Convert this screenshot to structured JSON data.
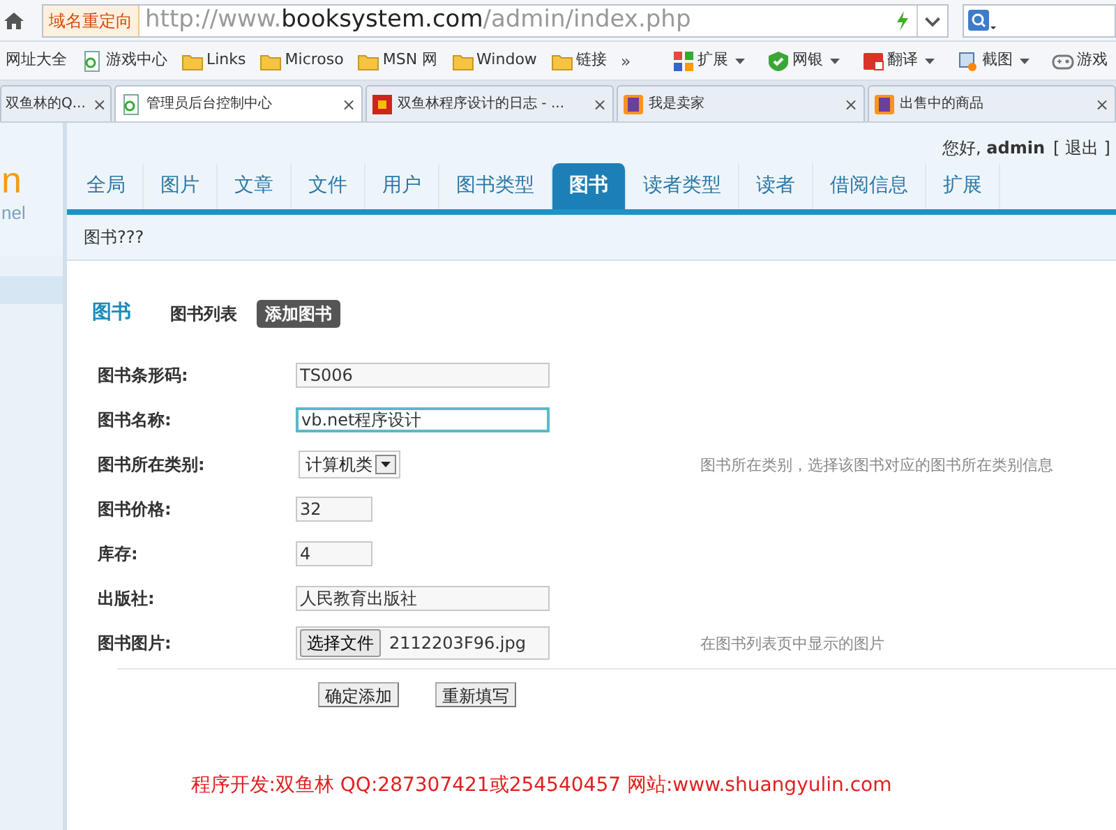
{
  "browser": {
    "address_badge": "域名重定向",
    "url": "http://www.**booksystem.com**/admin/index.php",
    "bookmarks": [
      {
        "label": "网址大全",
        "kind": "plain"
      },
      {
        "label": "游戏中心",
        "kind": "page"
      },
      {
        "label": "Links",
        "kind": "folder"
      },
      {
        "label": "Microso",
        "kind": "folder"
      },
      {
        "label": "MSN 网",
        "kind": "folder"
      },
      {
        "label": "Window",
        "kind": "folder"
      },
      {
        "label": "链接",
        "kind": "folder"
      }
    ],
    "bookmarks_more": "»",
    "tools": [
      {
        "label": "扩展",
        "menu": true
      },
      {
        "label": "网银",
        "menu": true
      },
      {
        "label": "翻译",
        "menu": true
      },
      {
        "label": "截图",
        "menu": true
      },
      {
        "label": "游戏",
        "menu": false
      }
    ],
    "tabs": [
      {
        "title": "双鱼林的Q...",
        "kind": "plain",
        "close": "×",
        "selected": false
      },
      {
        "title": "管理员后台控制中心",
        "kind": "page",
        "close": "×",
        "selected": true
      },
      {
        "title": "双鱼林程序设计的日志 - ...",
        "kind": "blog",
        "close": "×",
        "selected": false
      },
      {
        "title": "我是卖家",
        "kind": "shop",
        "close": "×",
        "selected": false
      },
      {
        "title": "出售中的商品",
        "kind": "shop",
        "close": "×",
        "selected": false
      }
    ]
  },
  "site": {
    "logo_letter": "n",
    "logo_sub": "nel",
    "greeting": "您好, ",
    "user": "admin",
    "logout": "[ 退出 ]",
    "nav": [
      {
        "label": "全局",
        "selected": false
      },
      {
        "label": "图片",
        "selected": false
      },
      {
        "label": "文章",
        "selected": false
      },
      {
        "label": "文件",
        "selected": false
      },
      {
        "label": "用户",
        "selected": false
      },
      {
        "label": "图书类型",
        "selected": false
      },
      {
        "label": "图书",
        "selected": true
      },
      {
        "label": "读者类型",
        "selected": false
      },
      {
        "label": "读者",
        "selected": false
      },
      {
        "label": "借阅信息",
        "selected": false
      },
      {
        "label": "扩展",
        "selected": false
      }
    ],
    "breadcrumb": "图书???"
  },
  "section": {
    "title": "图书",
    "subtabs": [
      {
        "label": "图书列表",
        "selected": false
      },
      {
        "label": "添加图书",
        "selected": true
      }
    ]
  },
  "form": {
    "fields": [
      {
        "label": "图书条形码:",
        "kind": "text",
        "value": "TS006",
        "focused": false
      },
      {
        "label": "图书名称:",
        "kind": "text",
        "value": "vb.net程序设计",
        "focused": true
      },
      {
        "label": "图书所在类别:",
        "kind": "select",
        "value": "计算机类",
        "focused": false,
        "hint": "图书所在类别，选择该图书对应的图书所在类别信息"
      },
      {
        "label": "图书价格:",
        "kind": "short",
        "value": "32",
        "focused": false
      },
      {
        "label": "库存:",
        "kind": "short",
        "value": "4",
        "focused": false
      },
      {
        "label": "出版社:",
        "kind": "text",
        "value": "人民教育出版社",
        "focused": false
      },
      {
        "label": "图书图片:",
        "kind": "file",
        "button": "选择文件",
        "value": "2112203F96.jpg",
        "focused": false,
        "hint": "在图书列表页中显示的图片"
      }
    ],
    "buttons": [
      "确定添加",
      "重新填写"
    ]
  },
  "footer": "程序开发:双鱼林 QQ:287307421或254540457 网站:www.shuangyulin.com"
}
